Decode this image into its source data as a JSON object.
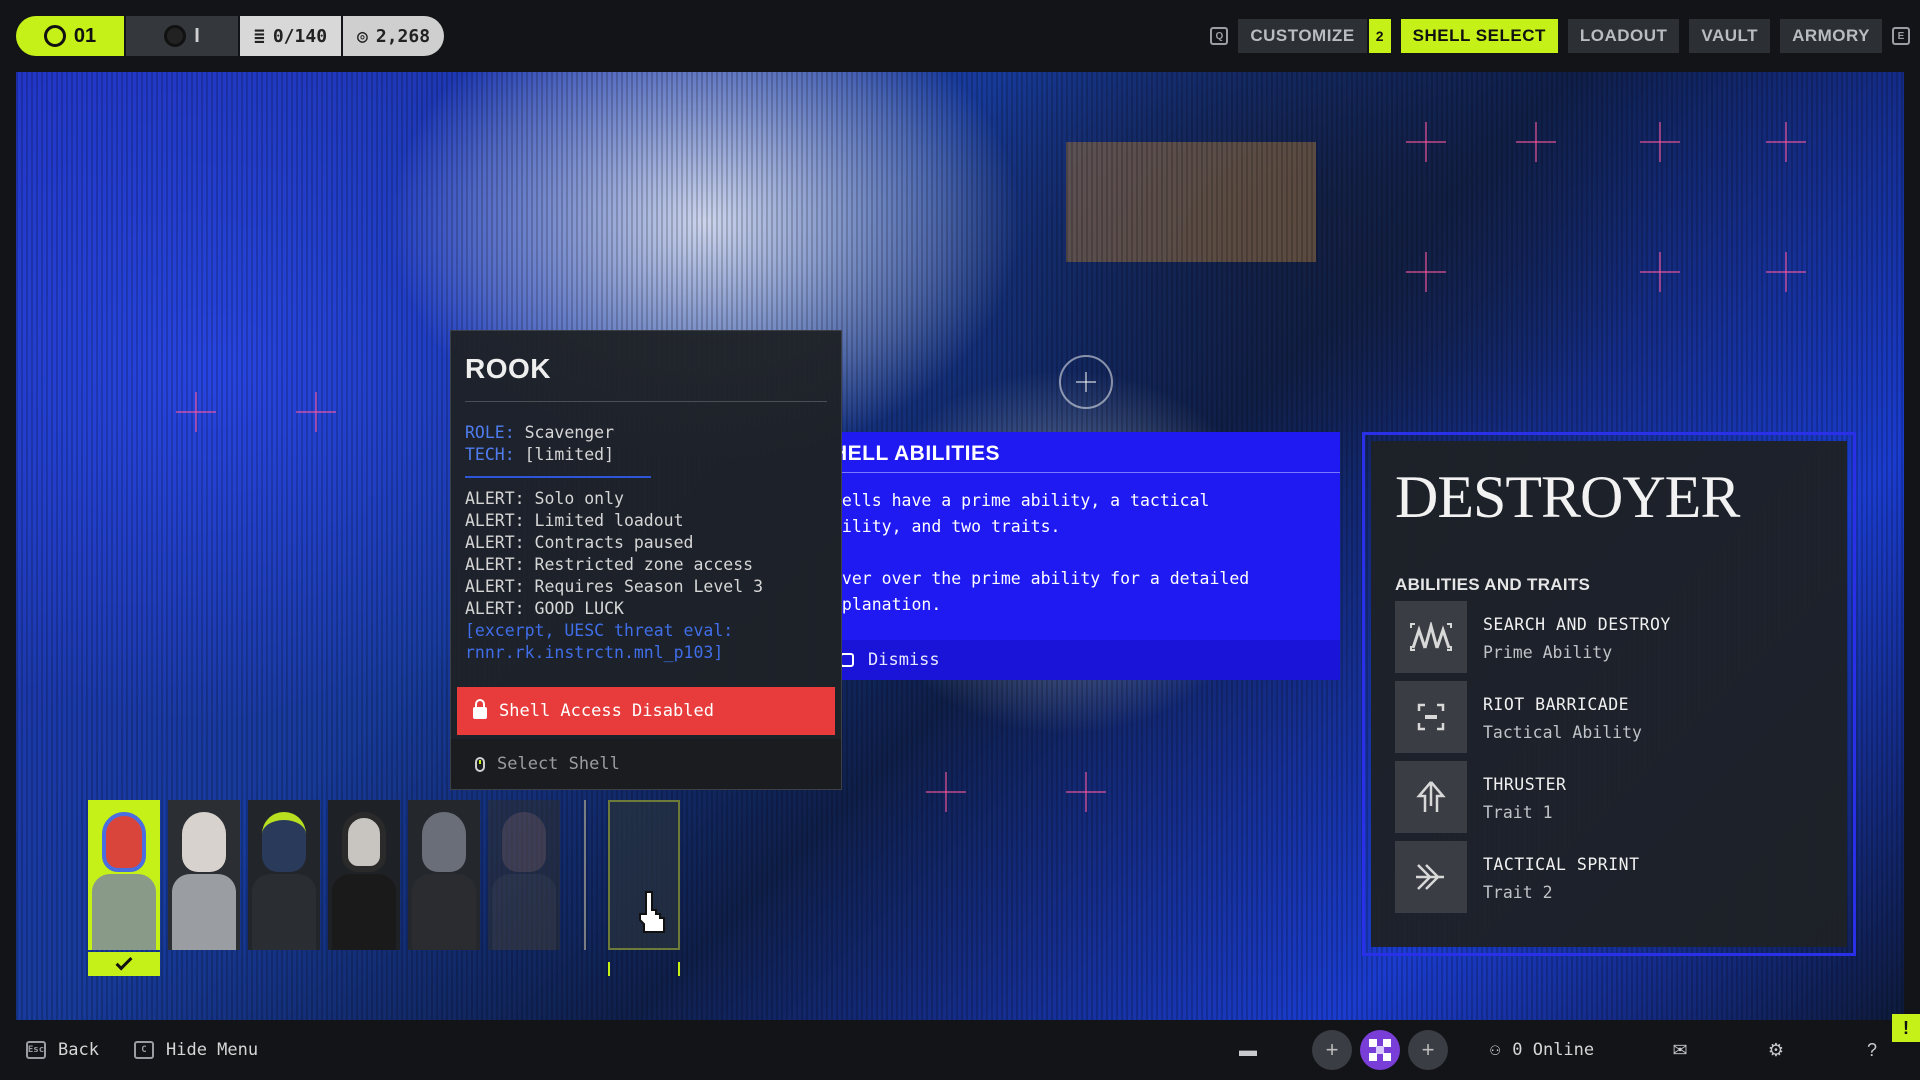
{
  "topbar": {
    "level": "01",
    "rank": "I",
    "stat_a": "0/140",
    "stat_b": "2,268",
    "nav_left_key": "Q",
    "nav_right_key": "E",
    "nav": [
      {
        "label": "CUSTOMIZE",
        "badge": "2",
        "active": false
      },
      {
        "label": "SHELL SELECT",
        "active": true
      },
      {
        "label": "LOADOUT",
        "active": false
      },
      {
        "label": "VAULT",
        "active": false
      },
      {
        "label": "ARMORY",
        "active": false
      }
    ]
  },
  "shell_card": {
    "title": "ROOK",
    "role_key": "ROLE:",
    "role_value": "Scavenger",
    "tech_key": "TECH:",
    "tech_value": "[limited]",
    "alerts": [
      "ALERT: Solo only",
      "ALERT: Limited loadout",
      "ALERT: Contracts paused",
      "ALERT: Restricted zone access",
      "ALERT: Requires Season Level 3",
      "ALERT: GOOD LUCK"
    ],
    "excerpt_1": "[excerpt, UESC threat eval:",
    "excerpt_2": "rnnr.rk.instrctn.mnl_p103]",
    "access_label": "Shell Access Disabled",
    "select_label": "Select Shell"
  },
  "abilities_tip": {
    "title": "HELL ABILITIES",
    "line_1": "hells have a prime ability, a tactical",
    "line_2": "bility, and two traits.",
    "line_3": "over over the prime ability for a detailed",
    "line_4": "xplanation.",
    "dismiss_label": "Dismiss"
  },
  "destroyer": {
    "title": "DESTROYER",
    "subtitle": "ABILITIES AND TRAITS",
    "abilities": [
      {
        "name": "SEARCH AND DESTROY",
        "type": "Prime Ability",
        "icon": "search-destroy-icon"
      },
      {
        "name": "RIOT BARRICADE",
        "type": "Tactical Ability",
        "icon": "barricade-icon"
      },
      {
        "name": "THRUSTER",
        "type": "Trait 1",
        "icon": "thruster-icon"
      },
      {
        "name": "TACTICAL SPRINT",
        "type": "Trait 2",
        "icon": "sprint-icon"
      }
    ]
  },
  "roster": {
    "selected_index": 0,
    "slot_colors": [
      "#c5f018",
      "#2b2e33",
      "#22262b",
      "#1e2126",
      "#24282d",
      "#2a2d31"
    ]
  },
  "bottombar": {
    "back_key": "Esc",
    "back_label": "Back",
    "hide_key": "C",
    "hide_label": "Hide Menu",
    "online_label": "0 Online",
    "alert_flag": "!"
  },
  "colors": {
    "accent": "#c5f018",
    "danger": "#e83c3c",
    "tooltip": "#1f19f2"
  }
}
